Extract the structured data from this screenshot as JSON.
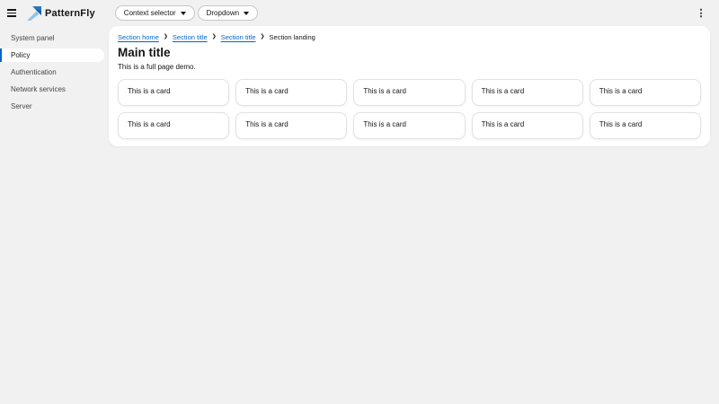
{
  "header": {
    "brand": "PatternFly",
    "context_selector_label": "Context selector",
    "dropdown_label": "Dropdown"
  },
  "icons": {
    "kebab": "⋮",
    "breadcrumb_separator": "❯"
  },
  "sidebar": {
    "items": [
      {
        "label": "System panel",
        "active": false
      },
      {
        "label": "Policy",
        "active": true
      },
      {
        "label": "Authentication",
        "active": false
      },
      {
        "label": "Network services",
        "active": false
      },
      {
        "label": "Server",
        "active": false
      }
    ]
  },
  "main": {
    "breadcrumb": [
      {
        "label": "Section home",
        "link": true
      },
      {
        "label": "Section title",
        "link": true
      },
      {
        "label": "Section title",
        "link": true
      },
      {
        "label": "Section landing",
        "link": false
      }
    ],
    "title": "Main title",
    "subtitle": "This is a full page demo.",
    "card_label": "This is a card",
    "cards_rows": 2,
    "cards_cols": 5
  },
  "colors": {
    "accent": "#0066cc",
    "page_bg": "#f1f1f1",
    "panel_bg": "#ffffff",
    "logo_light_blue": "#8fc4ec",
    "logo_dark_blue": "#2b77ba"
  }
}
